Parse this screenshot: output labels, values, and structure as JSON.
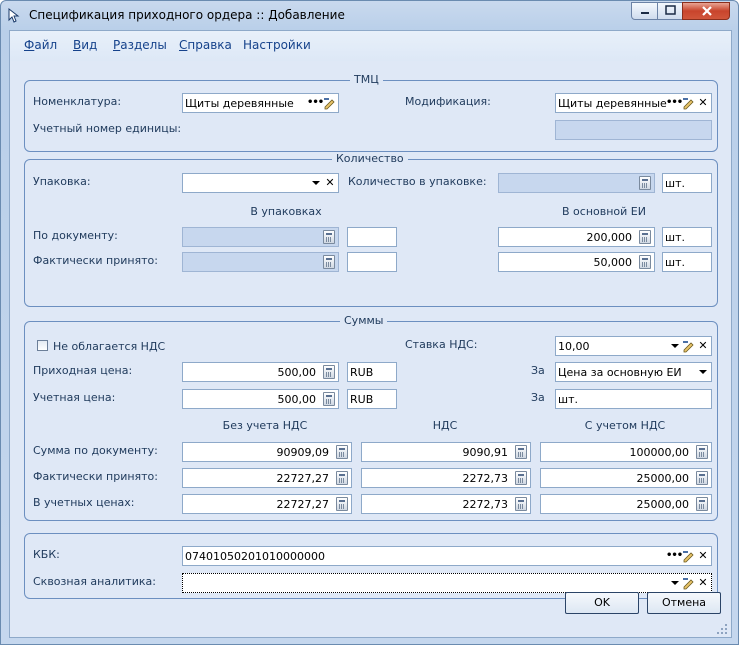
{
  "window": {
    "title": "Спецификация приходного ордера :: Добавление"
  },
  "menu": {
    "file": {
      "accel": "Ф",
      "rest": "айл"
    },
    "view": {
      "accel": "В",
      "rest": "ид"
    },
    "sections": {
      "accel": "Р",
      "rest": "азделы"
    },
    "help": {
      "accel": "С",
      "rest": "правка"
    },
    "settings": {
      "label": "Настройки"
    }
  },
  "tmc": {
    "legend": "ТМЦ",
    "nomenclature_label": "Номенклатура:",
    "nomenclature_value": "Щиты деревянные",
    "modification_label": "Модификация:",
    "modification_value": "Щиты деревянные",
    "account_number_label": "Учетный номер единицы:",
    "account_number_value": ""
  },
  "quantity": {
    "legend": "Количество",
    "packaging_label": "Упаковка:",
    "packaging_value": "",
    "qty_in_pack_label": "Количество в упаковке:",
    "qty_in_pack_value": "",
    "qty_in_pack_unit": "шт.",
    "col_packs": "В упаковках",
    "col_base": "В основной ЕИ",
    "by_doc_label": "По документу:",
    "by_doc_base": "200,000",
    "by_doc_unit": "шт.",
    "received_label": "Фактически принято:",
    "received_base": "50,000",
    "received_unit": "шт."
  },
  "sums": {
    "legend": "Суммы",
    "no_vat_label": "Не облагается НДС",
    "vat_rate_label": "Ставка НДС:",
    "vat_rate_value": "10,00",
    "purchase_price_label": "Приходная цена:",
    "purchase_price_value": "500,00",
    "purchase_currency": "RUB",
    "per_label_1": "За",
    "per_value_1": "Цена за основную ЕИ",
    "account_price_label": "Учетная цена:",
    "account_price_value": "500,00",
    "account_currency": "RUB",
    "per_label_2": "За",
    "per_value_2": "шт.",
    "col_without_vat": "Без учета НДС",
    "col_vat": "НДС",
    "col_with_vat": "С учетом НДС",
    "rows": [
      {
        "label": "Сумма по документу:",
        "without": "90909,09",
        "vat": "9090,91",
        "with": "100000,00"
      },
      {
        "label": "Фактически принято:",
        "without": "22727,27",
        "vat": "2272,73",
        "with": "25000,00"
      },
      {
        "label": "В учетных ценах:",
        "without": "22727,27",
        "vat": "2272,73",
        "with": "25000,00"
      }
    ]
  },
  "extra": {
    "kbk_label": "КБК:",
    "kbk_value": "07401050201010000000",
    "analytics_label": "Сквозная аналитика:",
    "analytics_value": ""
  },
  "buttons": {
    "ok": "OK",
    "cancel": "Отмена"
  }
}
